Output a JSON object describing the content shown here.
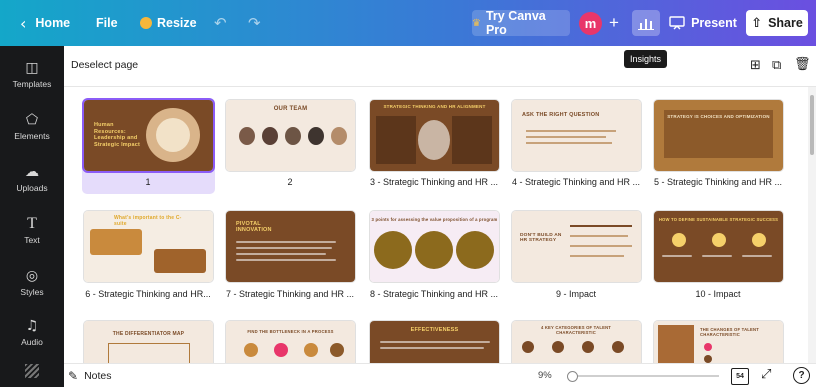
{
  "topbar": {
    "home_label": "Home",
    "file_label": "File",
    "resize_label": "Resize",
    "try_pro_label": "Try Canva Pro",
    "avatar_letter": "m",
    "present_label": "Present",
    "share_label": "Share"
  },
  "tooltip": {
    "text": "Insights"
  },
  "sidebar": {
    "items": [
      {
        "label": "Templates",
        "icon": "templates-icon"
      },
      {
        "label": "Elements",
        "icon": "elements-icon"
      },
      {
        "label": "Uploads",
        "icon": "uploads-icon"
      },
      {
        "label": "Text",
        "icon": "text-icon"
      },
      {
        "label": "Styles",
        "icon": "styles-icon"
      },
      {
        "label": "Audio",
        "icon": "audio-icon"
      }
    ]
  },
  "subbar": {
    "deselect_label": "Deselect page"
  },
  "pages": [
    {
      "caption": "1",
      "title": "Human Resources: Leadership and Strategic Impact",
      "bg": "#7a4a26",
      "selected": true
    },
    {
      "caption": "2",
      "title": "OUR TEAM",
      "bg": "#f3e9df"
    },
    {
      "caption": "3 - Strategic Thinking and HR ...",
      "title": "STRATEGIC THINKING AND HR ALIGNMENT",
      "bg": "#7a4a26"
    },
    {
      "caption": "4 - Strategic Thinking and HR ...",
      "title": "ASK THE RIGHT QUESTION",
      "bg": "#f3e9df"
    },
    {
      "caption": "5 - Strategic Thinking and HR ...",
      "title": "STRATEGY IS CHOICES AND OPTIMIZATION",
      "bg": "#b07a3c"
    },
    {
      "caption": "6 - Strategic Thinking and HR...",
      "title": "What's important to the C-suite",
      "bg": "#f5ede3"
    },
    {
      "caption": "7 - Strategic Thinking and HR ...",
      "title": "PIVOTAL INNOVATION",
      "bg": "#7a4a26"
    },
    {
      "caption": "8 - Strategic Thinking and HR ...",
      "title": "3 points for assessing the value proposition of a program",
      "bg": "#f6ecf4"
    },
    {
      "caption": "9 - Impact",
      "title": "DON'T BUILD AN HR STRATEGY",
      "bg": "#f3e9df"
    },
    {
      "caption": "10 - Impact",
      "title": "HOW TO DEFINE SUSTAINABLE STRATEGIC SUCCESS",
      "bg": "#7a4a26"
    },
    {
      "caption": "",
      "title": "THE DIFFERENTIATOR MAP",
      "bg": "#f3e9df"
    },
    {
      "caption": "",
      "title": "FIND THE BOTTLENECK IN A PROCESS",
      "bg": "#f3e9df"
    },
    {
      "caption": "",
      "title": "EFFECTIVENESS",
      "bg": "#7a4a26"
    },
    {
      "caption": "",
      "title": "4 KEY CATEGORIES OF TALENT CHARACTERISTIC",
      "bg": "#f3e9df"
    },
    {
      "caption": "",
      "title": "THE CHANGES OF TALENT CHARACTERISTIC",
      "bg": "#f3e9df"
    }
  ],
  "bottombar": {
    "notes_label": "Notes",
    "zoom": "9%",
    "page_count": "54"
  }
}
